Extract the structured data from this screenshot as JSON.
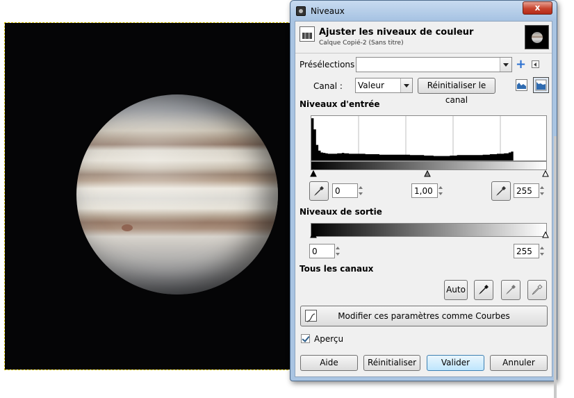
{
  "dialog": {
    "window_title": "Niveaux",
    "close_label": "x",
    "header_title": "Ajuster les niveaux de couleur",
    "header_subtitle": "Calque Copié-2 (Sans titre)"
  },
  "presets": {
    "label": "Présélections :",
    "value": ""
  },
  "channel": {
    "label": "Canal :",
    "value": "Valeur",
    "reset_label": "Réinitialiser le canal"
  },
  "input_levels": {
    "title": "Niveaux d'entrée",
    "low": "0",
    "gamma": "1,00",
    "high": "255",
    "histogram": [
      95,
      70,
      35,
      22,
      18,
      17,
      16,
      15,
      15,
      15,
      15,
      16,
      16,
      17,
      16,
      16,
      15,
      15,
      15,
      15,
      15,
      15,
      15,
      14,
      14,
      14,
      14,
      14,
      14,
      13,
      13,
      13,
      13,
      13,
      13,
      13,
      13,
      13,
      13,
      13,
      13,
      13,
      12,
      12,
      12,
      12,
      12,
      12,
      11,
      11,
      11,
      11,
      10,
      10,
      10,
      10,
      10,
      10,
      10,
      11,
      11,
      11,
      12,
      12,
      12,
      12,
      12,
      12,
      12,
      12,
      12,
      12,
      12,
      13,
      13,
      13,
      14,
      14,
      14,
      15,
      15,
      15,
      16,
      16,
      18,
      20,
      0,
      0,
      0,
      0,
      0,
      0,
      0,
      0,
      0,
      0,
      0,
      0,
      0,
      0
    ]
  },
  "output_levels": {
    "title": "Niveaux de sortie",
    "low": "0",
    "high": "255"
  },
  "all_channels": {
    "title": "Tous les canaux",
    "auto_label": "Auto"
  },
  "curves_button_label": "Modifier ces paramètres comme Courbes",
  "preview_label": "Aperçu",
  "buttons": {
    "help": "Aide",
    "reset": "Réinitialiser",
    "ok": "Valider",
    "cancel": "Annuler"
  }
}
